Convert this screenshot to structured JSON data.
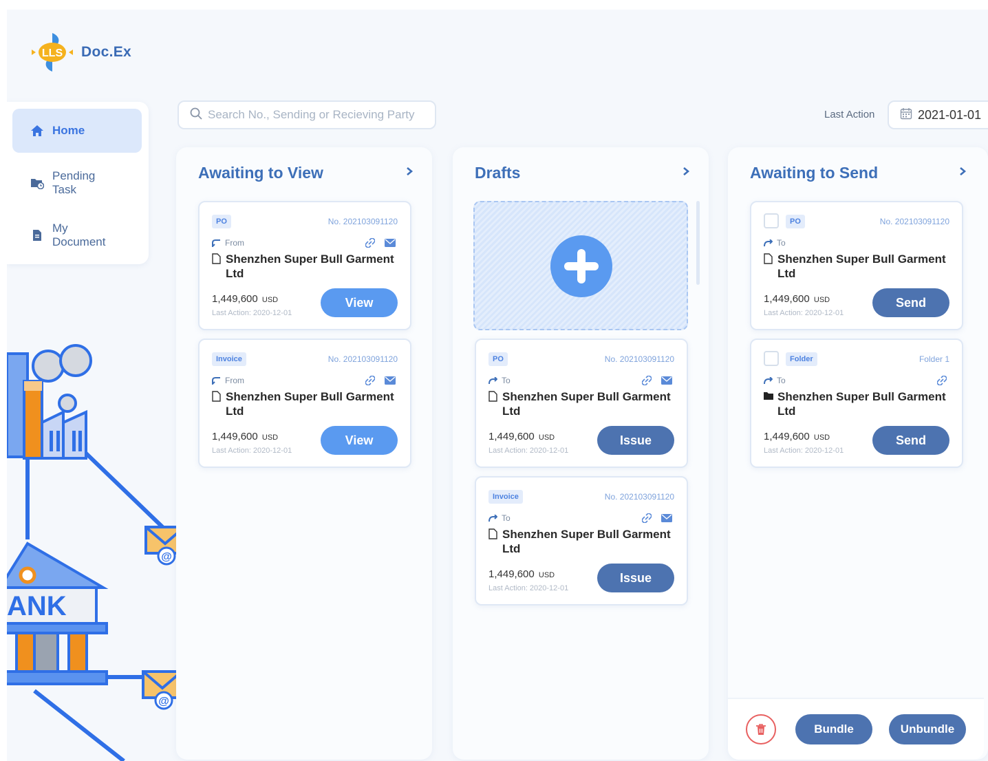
{
  "app": {
    "name": "Doc.Ex",
    "logo_letters": "LLS"
  },
  "sidebar": {
    "items": [
      {
        "label": "Home",
        "icon": "home-icon",
        "active": true
      },
      {
        "label": "Pending Task",
        "icon": "folder-clock-icon",
        "active": false
      },
      {
        "label": "My Document",
        "icon": "document-icon",
        "active": false
      }
    ]
  },
  "search": {
    "placeholder": "Search No., Sending or Recieving Party"
  },
  "filter": {
    "last_action_label": "Last Action",
    "date": "2021-01-01"
  },
  "illustration": {
    "bank_sign": "ANK"
  },
  "colors": {
    "accent": "#3d6fb8",
    "primary_button": "#5a9af0",
    "secondary_button": "#4d73b0",
    "tag_bg": "#e3ecfb",
    "danger": "#e86060",
    "orange": "#f0901e"
  },
  "columns": [
    {
      "title": "Awaiting to View",
      "cards": [
        {
          "tag": "PO",
          "number": "No. 202103091120",
          "direction": "From",
          "party": "Shenzhen Super Bull Garment Ltd",
          "amount": "1,449,600",
          "currency": "USD",
          "last_action": "Last Action: 2020-12-01",
          "button": "View"
        },
        {
          "tag": "Invoice",
          "number": "No. 202103091120",
          "direction": "From",
          "party": "Shenzhen Super Bull Garment Ltd",
          "amount": "1,449,600",
          "currency": "USD",
          "last_action": "Last Action: 2020-12-01",
          "button": "View"
        }
      ]
    },
    {
      "title": "Drafts",
      "cards": [
        {
          "tag": "PO",
          "number": "No. 202103091120",
          "direction": "To",
          "party": "Shenzhen Super Bull Garment Ltd",
          "amount": "1,449,600",
          "currency": "USD",
          "last_action": "Last Action: 2020-12-01",
          "button": "Issue"
        },
        {
          "tag": "Invoice",
          "number": "No. 202103091120",
          "direction": "To",
          "party": "Shenzhen Super Bull Garment Ltd",
          "amount": "1,449,600",
          "currency": "USD",
          "last_action": "Last Action: 2020-12-01",
          "button": "Issue"
        }
      ]
    },
    {
      "title": "Awaiting to Send",
      "cards": [
        {
          "tag": "PO",
          "number": "No. 202103091120",
          "direction": "To",
          "party": "Shenzhen Super Bull Garment Ltd",
          "amount": "1,449,600",
          "currency": "USD",
          "last_action": "Last Action: 2020-12-01",
          "button": "Send"
        },
        {
          "tag": "Folder",
          "number": "Folder 1",
          "direction": "To",
          "party": "Shenzhen Super Bull Garment Ltd",
          "amount": "1,449,600",
          "currency": "USD",
          "last_action": "Last Action: 2020-12-01",
          "button": "Send"
        }
      ],
      "footer": {
        "bundle": "Bundle",
        "unbundle": "Unbundle"
      }
    }
  ]
}
